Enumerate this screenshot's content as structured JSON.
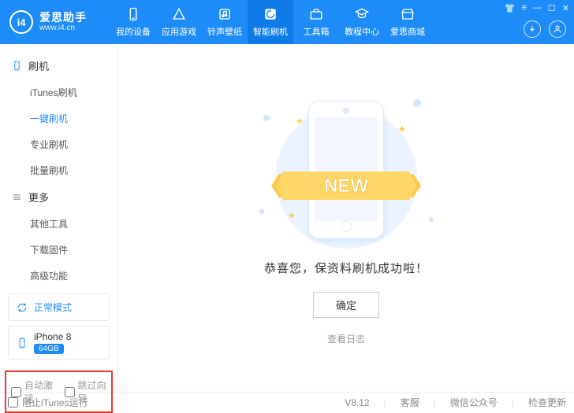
{
  "app": {
    "name": "爱思助手",
    "url": "www.i4.cn",
    "logo_text": "i4"
  },
  "nav": [
    {
      "label": "我的设备",
      "icon": "device"
    },
    {
      "label": "应用游戏",
      "icon": "app"
    },
    {
      "label": "铃声壁纸",
      "icon": "music"
    },
    {
      "label": "智能刷机",
      "icon": "flash",
      "active": true
    },
    {
      "label": "工具箱",
      "icon": "toolbox"
    },
    {
      "label": "教程中心",
      "icon": "tutorial"
    },
    {
      "label": "爱思商城",
      "icon": "shop"
    }
  ],
  "sidebar": {
    "group_flash": "刷机",
    "group_more": "更多",
    "items_flash": [
      {
        "label": "iTunes刷机"
      },
      {
        "label": "一键刷机",
        "active": true
      },
      {
        "label": "专业刷机"
      },
      {
        "label": "批量刷机"
      }
    ],
    "items_more": [
      {
        "label": "其他工具"
      },
      {
        "label": "下载固件"
      },
      {
        "label": "高级功能"
      }
    ],
    "status": "正常模式",
    "device": {
      "name": "iPhone 8",
      "storage": "64GB"
    },
    "opts": {
      "auto_activate": "自动激活",
      "skip_guide": "跳过向导"
    }
  },
  "main": {
    "ribbon_text": "NEW",
    "success": "恭喜您，保资料刷机成功啦！",
    "ok": "确定",
    "view_log": "查看日志"
  },
  "footer": {
    "block_itunes": "阻止iTunes运行",
    "version": "V8.12",
    "support": "客服",
    "wechat": "微信公众号",
    "check_update": "检查更新"
  }
}
